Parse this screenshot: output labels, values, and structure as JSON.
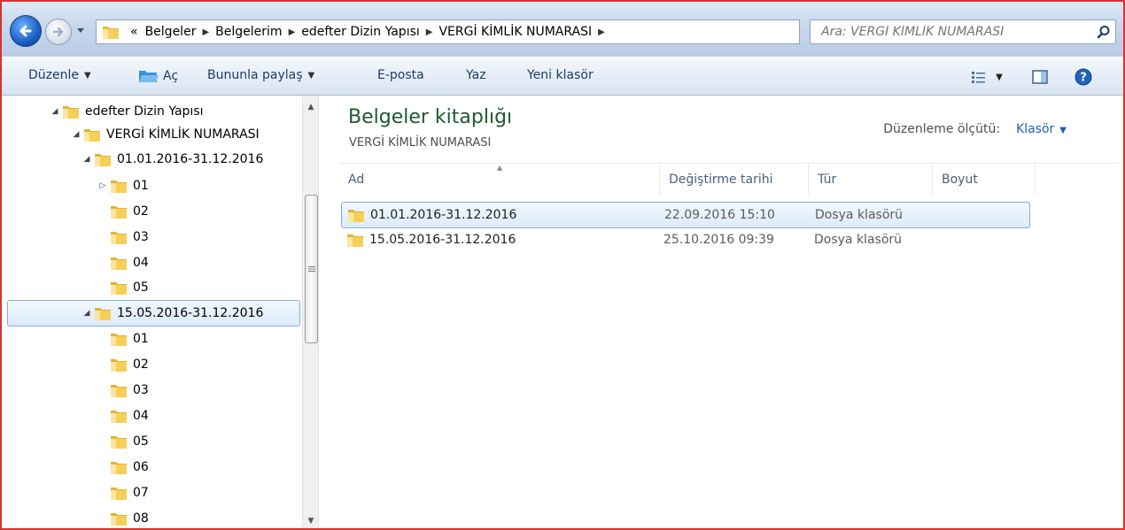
{
  "address": {
    "overflow": "«",
    "crumbs": [
      "Belgeler",
      "Belgelerim",
      "edefter Dizin Yapısı",
      "VERGİ KİMLİK NUMARASI"
    ],
    "search_placeholder": "Ara: VERGİ KİMLİK NUMARASI"
  },
  "toolbar": {
    "organize": "Düzenle",
    "open": "Aç",
    "share": "Bununla paylaş",
    "email": "E-posta",
    "print": "Yaz",
    "new_folder": "Yeni klasör"
  },
  "tree": [
    {
      "label": "edefter Dizin Yapısı",
      "toggle": "◢",
      "level": 0
    },
    {
      "label": "VERGİ KİMLİK NUMARASI",
      "toggle": "◢",
      "level": 1
    },
    {
      "label": "01.01.2016-31.12.2016",
      "toggle": "◢",
      "level": 2
    },
    {
      "label": "01",
      "toggle": "▷",
      "level": 3
    },
    {
      "label": "02",
      "toggle": "",
      "level": 3
    },
    {
      "label": "03",
      "toggle": "",
      "level": 3
    },
    {
      "label": "04",
      "toggle": "",
      "level": 3
    },
    {
      "label": "05",
      "toggle": "",
      "level": 3
    },
    {
      "label": "15.05.2016-31.12.2016",
      "toggle": "◢",
      "level": 2,
      "selected": true
    },
    {
      "label": "01",
      "toggle": "",
      "level": 3
    },
    {
      "label": "02",
      "toggle": "",
      "level": 3
    },
    {
      "label": "03",
      "toggle": "",
      "level": 3
    },
    {
      "label": "04",
      "toggle": "",
      "level": 3
    },
    {
      "label": "05",
      "toggle": "",
      "level": 3
    },
    {
      "label": "06",
      "toggle": "",
      "level": 3
    },
    {
      "label": "07",
      "toggle": "",
      "level": 3
    },
    {
      "label": "08",
      "toggle": "",
      "level": 3
    }
  ],
  "library": {
    "title": "Belgeler kitaplığı",
    "subtitle": "VERGİ KİMLİK NUMARASI",
    "arrange_label": "Düzenleme ölçütü:",
    "arrange_value": "Klasör"
  },
  "columns": {
    "name": "Ad",
    "modified": "Değiştirme tarihi",
    "type": "Tür",
    "size": "Boyut"
  },
  "files": [
    {
      "name": "01.01.2016-31.12.2016",
      "modified": "22.09.2016 15:10",
      "type": "Dosya klasörü",
      "size": "",
      "selected": true
    },
    {
      "name": "15.05.2016-31.12.2016",
      "modified": "25.10.2016 09:39",
      "type": "Dosya klasörü",
      "size": "",
      "selected": false
    }
  ],
  "icons": {
    "back": "back-arrow-icon",
    "forward": "forward-arrow-icon",
    "folder": "folder-icon",
    "search": "search-icon",
    "refresh": "refresh-icon",
    "views": "views-icon",
    "preview_pane": "preview-pane-icon",
    "help": "help-icon"
  },
  "colors": {
    "accent_border": "#d9322e",
    "library_title": "#1e5a30",
    "link_blue": "#1e5fb4",
    "selection_border": "#84acdd"
  }
}
